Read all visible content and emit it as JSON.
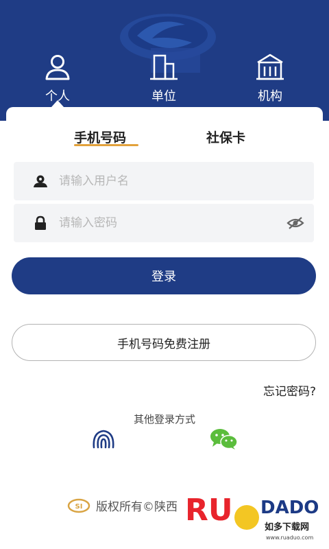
{
  "top_tabs": [
    {
      "label": "个人",
      "icon": "person-icon",
      "active": true
    },
    {
      "label": "单位",
      "icon": "building-icon"
    },
    {
      "label": "机构",
      "icon": "institution-icon"
    }
  ],
  "login_tabs": {
    "phone": "手机号码",
    "social_card": "社保卡"
  },
  "form": {
    "username_placeholder": "请输入用户名",
    "password_placeholder": "请输入密码",
    "login_button": "登录",
    "register_button": "手机号码免费注册",
    "forgot_password": "忘记密码?"
  },
  "other_login": {
    "title": "其他登录方式",
    "methods": [
      "fingerprint-icon",
      "wechat-icon"
    ]
  },
  "footer": {
    "copyright": "版权所有©陕西"
  },
  "watermark": {
    "brand": "RUANDADO",
    "subtitle": "如多下载网",
    "url": "www.ruaduo.com"
  },
  "colors": {
    "primary": "#1f3c85",
    "accent": "#e2a13b",
    "wechat": "#5bbd3c"
  }
}
